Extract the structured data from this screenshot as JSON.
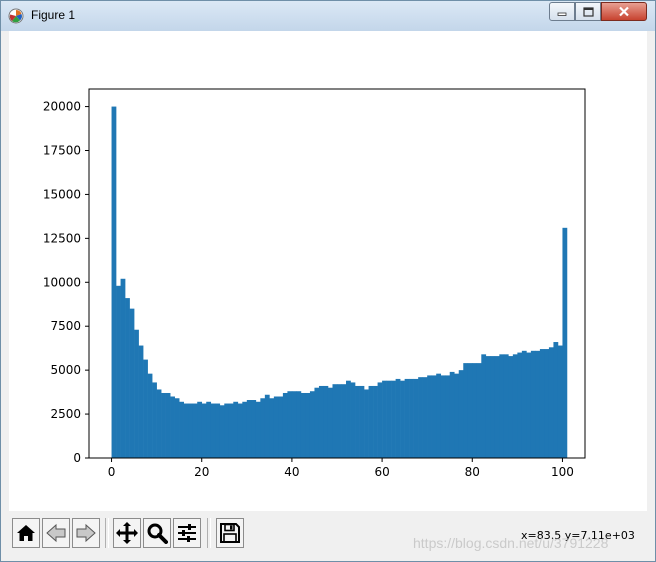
{
  "window": {
    "title": "Figure 1"
  },
  "chart_data": {
    "type": "bar",
    "title": "",
    "xlabel": "",
    "ylabel": "",
    "xlim": [
      -5,
      105
    ],
    "ylim": [
      0,
      21000
    ],
    "x_ticks": [
      0,
      20,
      40,
      60,
      80,
      100
    ],
    "y_ticks": [
      0,
      2500,
      5000,
      7500,
      10000,
      12500,
      15000,
      17500,
      20000
    ],
    "bin_start": 0,
    "bin_width": 1,
    "bar_color": "#1f77b4",
    "grid": false,
    "values": [
      20000,
      9800,
      10200,
      9100,
      8500,
      7300,
      6400,
      5600,
      4800,
      4300,
      3900,
      3700,
      3700,
      3500,
      3400,
      3200,
      3100,
      3100,
      3100,
      3200,
      3100,
      3200,
      3100,
      3100,
      3000,
      3100,
      3100,
      3200,
      3100,
      3200,
      3300,
      3300,
      3200,
      3400,
      3600,
      3400,
      3500,
      3500,
      3700,
      3800,
      3800,
      3800,
      3700,
      3700,
      3800,
      4000,
      4100,
      4100,
      4000,
      4200,
      4200,
      4200,
      4400,
      4300,
      4100,
      4100,
      3900,
      4100,
      4100,
      4300,
      4400,
      4400,
      4400,
      4500,
      4400,
      4500,
      4500,
      4500,
      4600,
      4600,
      4700,
      4700,
      4800,
      4700,
      4700,
      4900,
      4800,
      5000,
      5400,
      5400,
      5400,
      5400,
      5900,
      5800,
      5800,
      5800,
      5900,
      5900,
      5800,
      5900,
      6000,
      6100,
      6000,
      6100,
      6100,
      6200,
      6200,
      6300,
      6600,
      6400,
      13100
    ]
  },
  "toolbar": {
    "buttons": [
      {
        "name": "home-icon"
      },
      {
        "name": "back-icon"
      },
      {
        "name": "forward-icon"
      },
      {
        "name": "pan-icon"
      },
      {
        "name": "zoom-icon"
      },
      {
        "name": "configure-subplots-icon"
      },
      {
        "name": "save-icon"
      }
    ],
    "coordinates": "x=83.5 y=7.11e+03"
  },
  "watermark": "https://blog.csdn.net/u/3791228"
}
